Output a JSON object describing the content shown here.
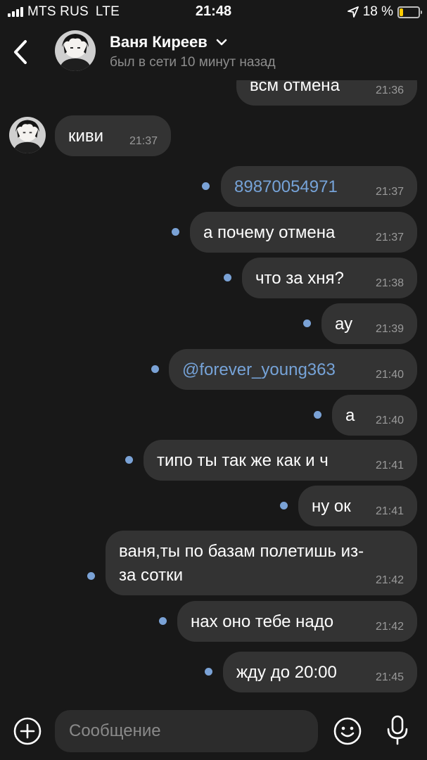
{
  "status_bar": {
    "carrier": "MTS RUS",
    "network": "LTE",
    "time": "21:48",
    "battery_percent": "18 %",
    "battery_level": 0.18
  },
  "header": {
    "contact_name": "Ваня Киреев",
    "contact_status": "был в сети 10 минут назад"
  },
  "messages": [
    {
      "text": "всм отмена",
      "time": "21:36",
      "direction": "out",
      "unread": false
    },
    {
      "text": "киви",
      "time": "21:37",
      "direction": "in",
      "unread": false
    },
    {
      "text": "89870054971",
      "time": "21:37",
      "direction": "out",
      "unread": true,
      "link": true
    },
    {
      "text": "а почему отмена",
      "time": "21:37",
      "direction": "out",
      "unread": true
    },
    {
      "text": "что за хня?",
      "time": "21:38",
      "direction": "out",
      "unread": true
    },
    {
      "text": "ау",
      "time": "21:39",
      "direction": "out",
      "unread": true
    },
    {
      "text": "@forever_young363",
      "time": "21:40",
      "direction": "out",
      "unread": true,
      "link": true
    },
    {
      "text": "а",
      "time": "21:40",
      "direction": "out",
      "unread": true
    },
    {
      "text": "типо ты так же как и ч",
      "time": "21:41",
      "direction": "out",
      "unread": true
    },
    {
      "text": "ну ок",
      "time": "21:41",
      "direction": "out",
      "unread": true
    },
    {
      "text": "ваня,ты по базам полетишь из-\nза сотки",
      "time": "21:42",
      "direction": "out",
      "unread": true
    },
    {
      "text": "нах оно тебе надо",
      "time": "21:42",
      "direction": "out",
      "unread": true
    },
    {
      "text": "жду до 20:00",
      "time": "21:45",
      "direction": "out",
      "unread": true
    }
  ],
  "composer": {
    "placeholder": "Сообщение"
  },
  "icons": {
    "back": "chevron-left-icon",
    "dropdown": "chevron-down-icon",
    "add": "plus-circle-icon",
    "emoji": "smiley-icon",
    "mic": "microphone-icon",
    "location": "location-arrow-icon"
  },
  "colors": {
    "background": "#181818",
    "bubble": "#333333",
    "link": "#76a3d8",
    "unread_dot": "#7aa2d6",
    "battery": "#ffcc00"
  }
}
